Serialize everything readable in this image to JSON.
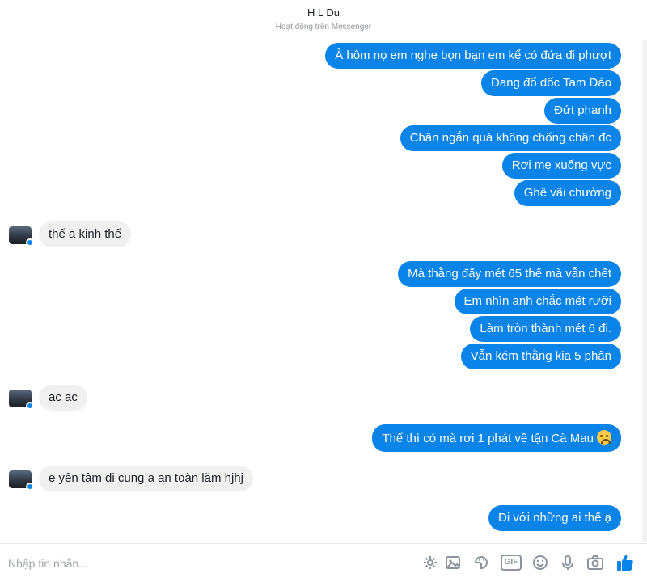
{
  "header": {
    "contact_name": "H     L Du",
    "status": "Hoạt động trên Messenger"
  },
  "messages": [
    {
      "side": "out",
      "text": "À hôm nọ em nghe bọn bạn em kể có đứa đi phượt"
    },
    {
      "side": "out",
      "text": "Đang đổ dốc Tam Đảo"
    },
    {
      "side": "out",
      "text": "Đứt phanh"
    },
    {
      "side": "out",
      "text": "Chân ngắn quá không chống chân đc"
    },
    {
      "side": "out",
      "text": "Rơi mẹ xuống vực"
    },
    {
      "side": "out",
      "text": "Ghê vãi chưởng"
    },
    {
      "side": "in",
      "text": "thế a kinh thế"
    },
    {
      "side": "out",
      "text": "Mà thằng đấy mét 65 thế mà vẫn chết"
    },
    {
      "side": "out",
      "text": "Em nhìn anh chắc mét rưỡi"
    },
    {
      "side": "out",
      "text": "Làm tròn thành mét 6 đi."
    },
    {
      "side": "out",
      "text": "Vẫn kém thằng kia 5 phân"
    },
    {
      "side": "in",
      "text": "ac ac"
    },
    {
      "side": "out",
      "text": "Thế thì có mà rơi 1 phát về tận Cà Mau",
      "emoji": "sad-face-emoji"
    },
    {
      "side": "in",
      "text": "e yên tâm đi cung a an toàn lăm hjhj"
    },
    {
      "side": "out",
      "text": "Đi với những ai thế ạ"
    }
  ],
  "composer": {
    "placeholder": "Nhập tin nhắn...",
    "tools": [
      "emoji-sticker-icon",
      "image-icon",
      "sticker-icon",
      "gif-icon",
      "smiley-icon",
      "microphone-icon",
      "camera-icon",
      "like-icon"
    ],
    "gif_label": "GIF"
  },
  "colors": {
    "outgoing_bubble": "#0a84e8",
    "incoming_bubble": "#f1f0f0",
    "like_icon": "#0a84e8"
  }
}
